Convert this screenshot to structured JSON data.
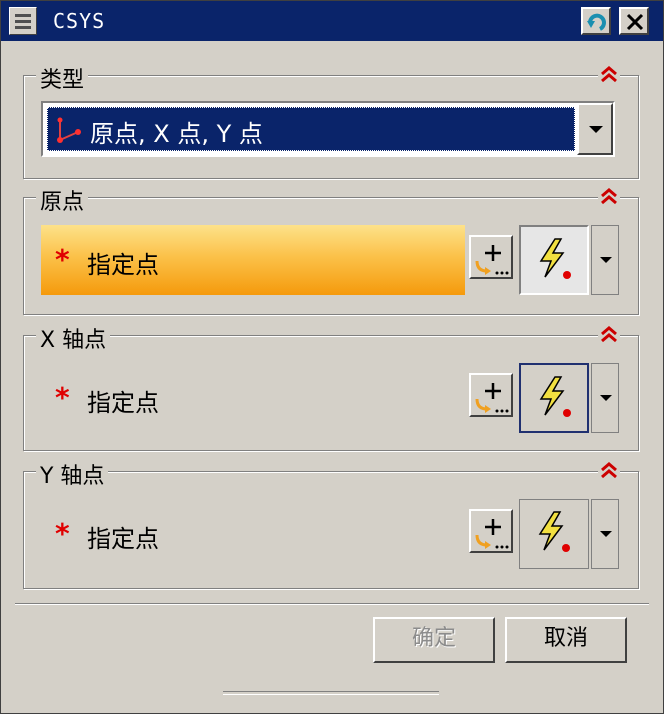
{
  "window": {
    "title": "CSYS",
    "menu_icon": "menu-icon",
    "back_icon": "back-arrow-icon",
    "close_icon": "close-icon"
  },
  "type_group": {
    "title": "类型",
    "selected": "原点, X 点, Y 点",
    "icon": "csys-origin-xy-icon"
  },
  "groups": [
    {
      "title": "原点",
      "row_label": "指定点"
    },
    {
      "title": "X 轴点",
      "row_label": "指定点"
    },
    {
      "title": "Y 轴点",
      "row_label": "指定点"
    }
  ],
  "required_marker": "*",
  "buttons": {
    "ok": "确定",
    "cancel": "取消"
  },
  "colors": {
    "title_bar": "#0a246a",
    "active_row": "#f9b233",
    "required": "#e00000",
    "collapse": "#cc0000"
  }
}
